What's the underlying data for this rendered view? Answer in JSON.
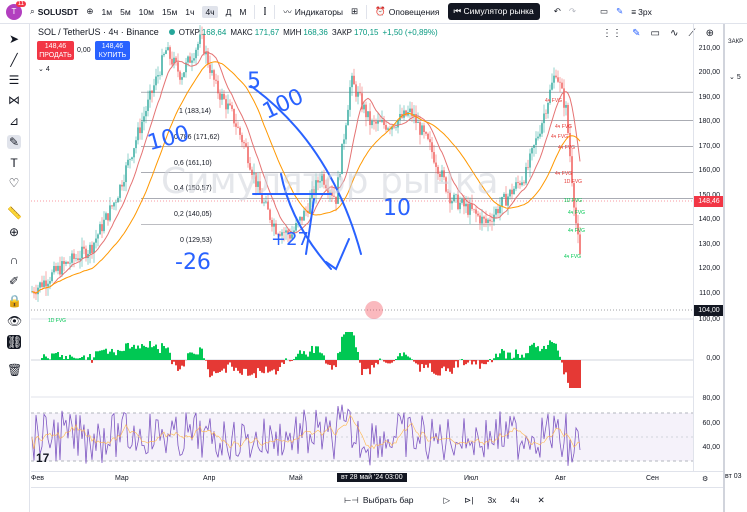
{
  "topbar": {
    "avatar": "T",
    "notif": "11",
    "symbol": "SOLUSDT",
    "timeframes": [
      "1м",
      "5м",
      "10м",
      "15м",
      "1ч",
      "4ч",
      "Д",
      "М"
    ],
    "active_tf": "4ч",
    "indicators": "Индикаторы",
    "alerts": "Оповещения",
    "replay": "Симулятор рынка",
    "size": "3px"
  },
  "legend": {
    "title": "SOL / TetherUS · 4ч · Binance",
    "open_label": "ОТКР",
    "open": "168,64",
    "high_label": "МАКС",
    "high": "171,67",
    "low_label": "МИН",
    "low": "168,36",
    "close_label": "ЗАКР",
    "close": "170,15",
    "change": "+1,50 (+0,89%)",
    "collapse": "4"
  },
  "trade": {
    "sell_price": "148,46",
    "sell_label": "ПРОДАТЬ",
    "spread": "0,00",
    "buy_price": "148,46",
    "buy_label": "КУПИТЬ"
  },
  "fib_levels": [
    {
      "ratio": "1",
      "price": "(183,14)"
    },
    {
      "ratio": "0,786",
      "price": "(171,62)"
    },
    {
      "ratio": "0,6",
      "price": "(161,10)"
    },
    {
      "ratio": "0,4",
      "price": "(150,57)"
    },
    {
      "ratio": "0,2",
      "price": "(140,05)"
    },
    {
      "ratio": "0",
      "price": "(129,53)"
    }
  ],
  "price_axis": [
    "210,00",
    "200,00",
    "190,00",
    "180,00",
    "170,00",
    "160,00",
    "150,00",
    "140,00",
    "130,00",
    "120,00",
    "110,00",
    "100,00"
  ],
  "price_tags": {
    "current": "148,46",
    "marker": "104,00"
  },
  "osc_axis": [
    "0,00"
  ],
  "rsi_axis": [
    "80,00",
    "60,00",
    "40,00"
  ],
  "time_axis": [
    "Фев",
    "Мар",
    "Апр",
    "Май",
    "Июл",
    "Авг",
    "Сен"
  ],
  "time_tag": "вт 28 май '24   03:00",
  "bottombar": {
    "select_bar": "Выбрать бар",
    "speed": "3x",
    "interval": "4ч"
  },
  "right_panel": {
    "top": "ЗАКР",
    "num": "5",
    "bottom": "вт 03"
  },
  "handwriting": [
    "5",
    "100",
    "100",
    "-26",
    "+27",
    "10"
  ],
  "watermark": "Симулятор рынка",
  "fvg_labels": [
    "4ч FVG",
    "4ч FVG",
    "4ч FVG",
    "4ч FVG",
    "4ч FVG",
    "1D FVG",
    "1D FVG",
    "4ч FVG",
    "4ч FVG",
    "4ч FVG"
  ],
  "fvg_left": "1D FVG",
  "logo": "17",
  "colors": {
    "up": "#00c853",
    "down": "#e53935",
    "rsi": "#7e57c2",
    "fib": "#787b86",
    "pen": "#2962ff"
  }
}
